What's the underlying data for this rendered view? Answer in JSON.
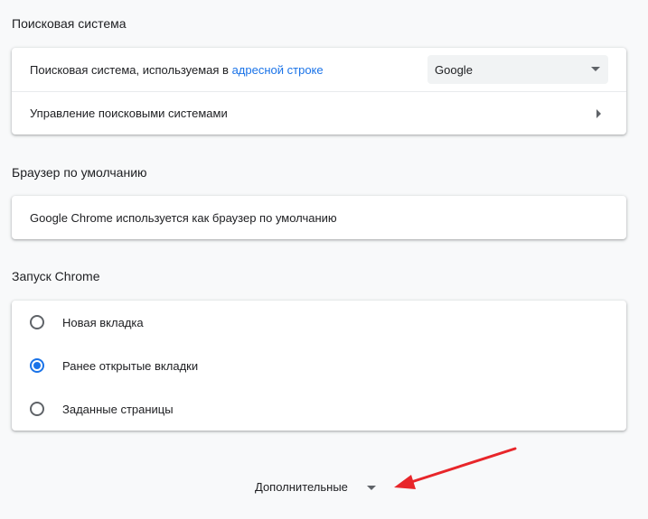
{
  "search_engine": {
    "title": "Поисковая система",
    "used_in_label_prefix": "Поисковая система, используемая в ",
    "used_in_link": "адресной строке",
    "selected_engine": "Google",
    "manage_label": "Управление поисковыми системами"
  },
  "default_browser": {
    "title": "Браузер по умолчанию",
    "status": "Google Chrome используется как браузер по умолчанию"
  },
  "startup": {
    "title": "Запуск Chrome",
    "options": [
      {
        "label": "Новая вкладка",
        "checked": false
      },
      {
        "label": "Ранее открытые вкладки",
        "checked": true
      },
      {
        "label": "Заданные страницы",
        "checked": false
      }
    ]
  },
  "advanced": {
    "label": "Дополнительные"
  },
  "colors": {
    "accent": "#1a73e8",
    "annotation_arrow": "#e8262a"
  },
  "icons": {
    "dropdown": "triangle-down-icon",
    "submenu": "chevron-right-icon",
    "annotation": "red-arrow-icon"
  }
}
